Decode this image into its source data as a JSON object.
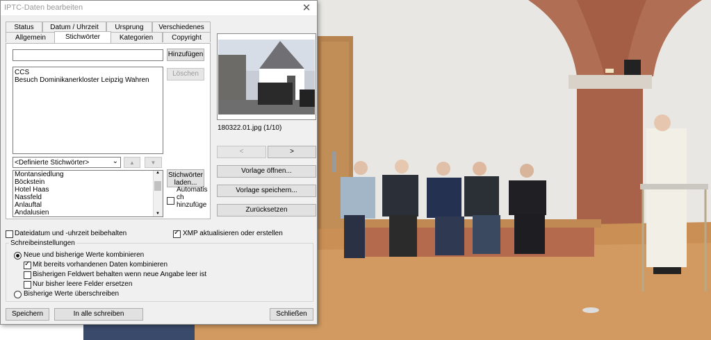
{
  "window": {
    "title": "IPTC-Daten bearbeiten",
    "close_symbol": "✕"
  },
  "tabs": {
    "row1": [
      "Status",
      "Datum / Uhrzeit",
      "Ursprung",
      "Verschiedenes"
    ],
    "row2": [
      "Allgemein",
      "Stichwörter",
      "Kategorien",
      "Copyright"
    ],
    "active": "Stichwörter"
  },
  "keywords": {
    "input_value": "",
    "add_button": "Hinzufügen",
    "delete_button": "Löschen",
    "current": [
      "CCS",
      "Besuch Dominikanerkloster Leipzig Wahren"
    ],
    "defined_select": "<Definierte Stichwörter>",
    "defined_list": [
      "Montansiedlung",
      "Böckstein",
      "Hotel Haas",
      "Nassfeld",
      "Anlauftal",
      "Andalusien"
    ],
    "load_button": [
      "Stichwörter",
      "laden..."
    ],
    "auto_label": [
      "Automatis",
      "ch",
      "hinzufüge"
    ]
  },
  "preview": {
    "filename": "180322.01.jpg (1/10)",
    "prev_label": "<",
    "next_label": ">",
    "open_template": "Vorlage öffnen...",
    "save_template": "Vorlage speichern...",
    "reset": "Zurücksetzen"
  },
  "options": {
    "keep_date": {
      "label": "Dateidatum und -uhrzeit beibehalten",
      "checked": false
    },
    "xmp": {
      "label": "XMP aktualisieren oder erstellen",
      "checked": true
    }
  },
  "write_settings": {
    "group_label": "Schreibeinstellungen",
    "radio_combine": {
      "label": "Neue und bisherige Werte kombinieren",
      "checked": true
    },
    "cb_combine_existing": {
      "label": "Mit bereits vorhandenen Daten kombinieren",
      "checked": true
    },
    "cb_keep_field": {
      "label": "Bisherigen Feldwert behalten wenn neue Angabe leer ist",
      "checked": false
    },
    "cb_empty_only": {
      "label": "Nur bisher leere Felder ersetzen",
      "checked": false
    },
    "radio_overwrite": {
      "label": "Bisherige Werte überschreiben",
      "checked": false
    }
  },
  "footer": {
    "save": "Speichern",
    "write_all": "In alle schreiben",
    "close": "Schließen"
  }
}
